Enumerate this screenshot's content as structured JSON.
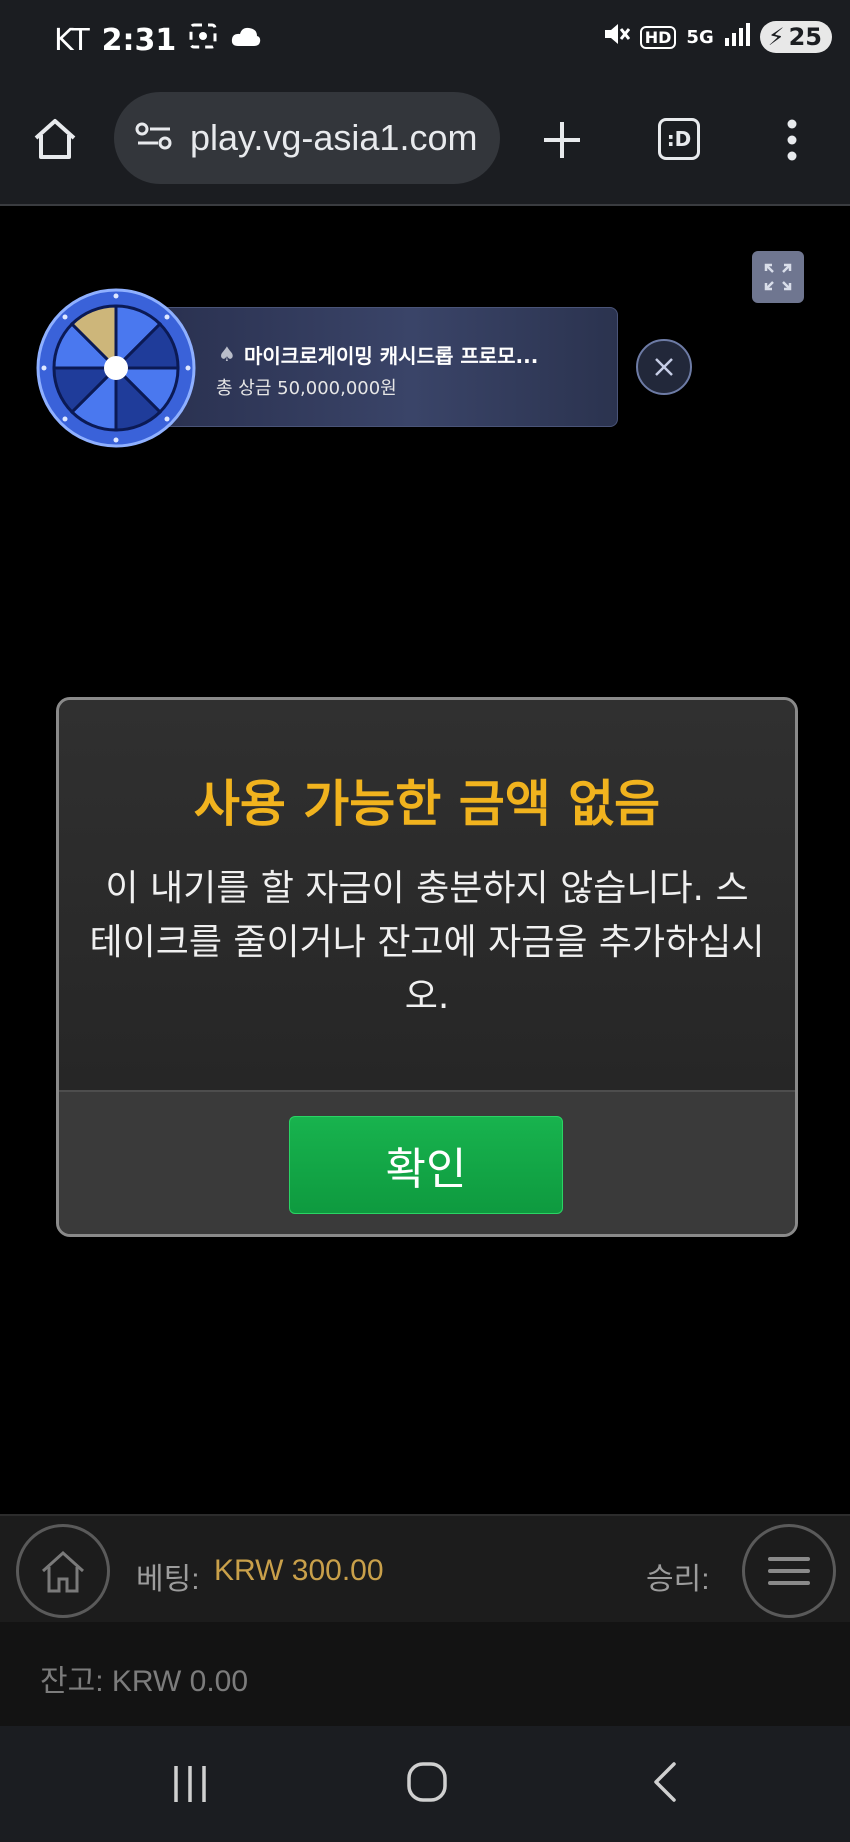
{
  "status_bar": {
    "carrier": "KT",
    "time": "2:31",
    "network": "5G",
    "hd": "HD",
    "battery": "25"
  },
  "browser": {
    "url": "play.vg-asia1.com",
    "tab_label": ":D"
  },
  "promo": {
    "title": "마이크로게이밍 캐시드롭 프로모...",
    "subtitle": "총 상금 50,000,000원"
  },
  "dialog": {
    "title": "사용 가능한 금액 없음",
    "body": "이 내기를 할 자금이 충분하지 않습니다. 스테이크를 줄이거나 잔고에 자금을 추가하십시오.",
    "confirm_label": "확인"
  },
  "game_bar": {
    "bet_label": "베팅:",
    "bet_value": "KRW 300.00",
    "win_label": "승리:",
    "balance_text": "잔고: KRW 0.00"
  },
  "colors": {
    "title_gold": "#f1b31e",
    "confirm_green": "#12a546",
    "bet_gold": "#c9a04a"
  }
}
